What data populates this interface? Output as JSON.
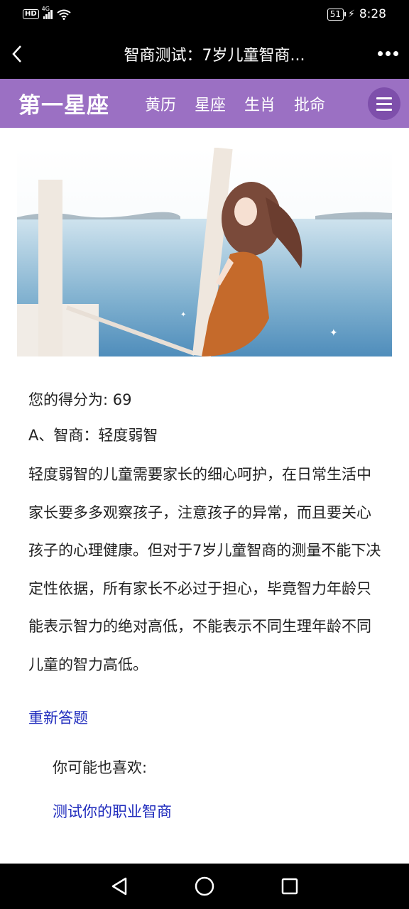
{
  "status": {
    "hd": "HD",
    "network": "4G",
    "battery": "51",
    "time": "8:28"
  },
  "titlebar": {
    "title": "智商测试：7岁儿童智商..."
  },
  "site": {
    "logo": "第一星座",
    "nav": [
      "黄历",
      "星座",
      "生肖",
      "批命"
    ]
  },
  "result": {
    "score_line": "您的得分为: 69",
    "level": "A、智商：轻度弱智",
    "description": "轻度弱智的儿童需要家长的细心呵护，在日常生活中家长要多多观察孩子，注意孩子的异常，而且要关心孩子的心理健康。但对于7岁儿童智商的测量不能下决定性依据，所有家长不必过于担心，毕竟智力年龄只能表示智力的绝对高低，不能表示不同生理年龄不同儿童的智力高低。",
    "retake": "重新答题"
  },
  "recommend": {
    "label": "你可能也喜欢:",
    "link": "测试你的职业智商"
  },
  "colors": {
    "header_bg": "#9b70c3",
    "link": "#1f2bbd"
  }
}
